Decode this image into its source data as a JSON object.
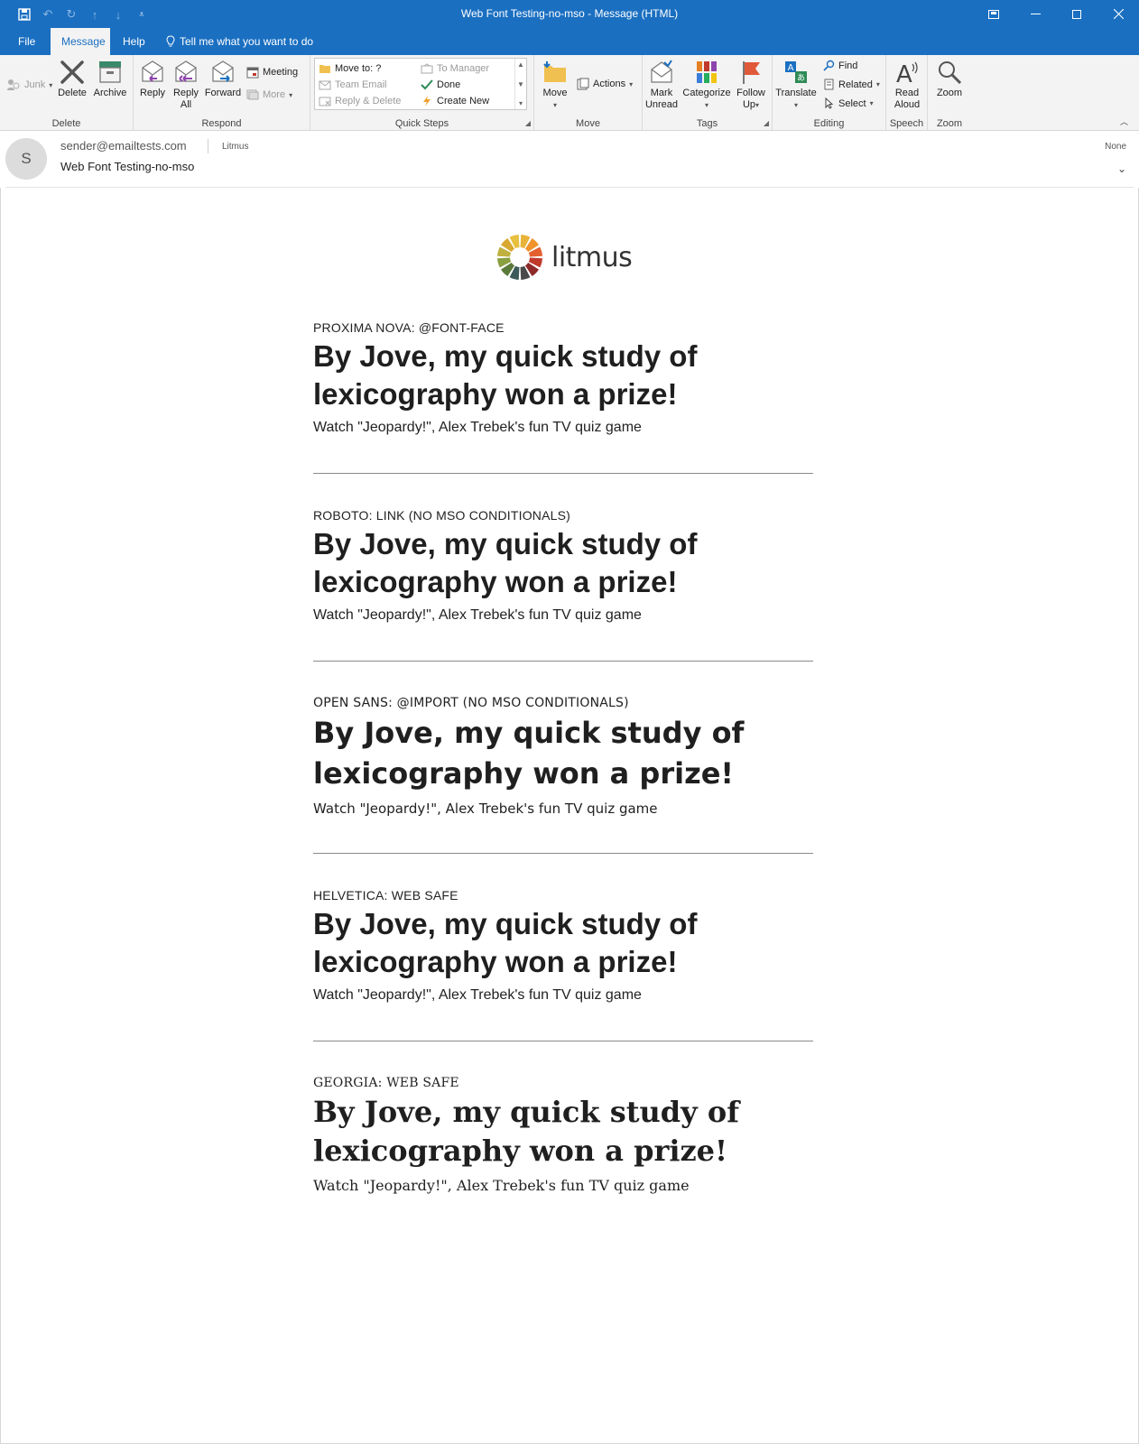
{
  "window": {
    "title": "Web Font Testing-no-mso  -  Message (HTML)"
  },
  "tabs": [
    {
      "label": "File"
    },
    {
      "label": "Message"
    },
    {
      "label": "Help"
    },
    {
      "label": "Tell me what you want to do"
    }
  ],
  "ribbon": {
    "delete_group": {
      "label": "Delete",
      "junk": "Junk",
      "delete": "Delete",
      "archive": "Archive"
    },
    "respond_group": {
      "label": "Respond",
      "reply": "Reply",
      "reply_all_1": "Reply",
      "reply_all_2": "All",
      "forward": "Forward",
      "meeting": "Meeting",
      "more": "More"
    },
    "quicksteps_group": {
      "label": "Quick Steps",
      "move_to": "Move to: ?",
      "team_email": "Team Email",
      "reply_delete": "Reply & Delete",
      "to_manager": "To Manager",
      "done": "Done",
      "create_new": "Create New"
    },
    "move_group": {
      "label": "Move",
      "move": "Move",
      "actions": "Actions"
    },
    "tags_group": {
      "label": "Tags",
      "mark_unread_1": "Mark",
      "mark_unread_2": "Unread",
      "categorize": "Categorize",
      "follow_up_1": "Follow",
      "follow_up_2": "Up"
    },
    "editing_group": {
      "label": "Editing",
      "translate": "Translate",
      "find": "Find",
      "related": "Related",
      "select": "Select"
    },
    "speech_group": {
      "label": "Speech",
      "read_aloud_1": "Read",
      "read_aloud_2": "Aloud"
    },
    "zoom_group": {
      "label": "Zoom",
      "zoom": "Zoom"
    }
  },
  "message": {
    "avatar_initial": "S",
    "from": "sender@emailtests.com",
    "to": "Litmus",
    "subject": "Web Font Testing-no-mso",
    "retention": "None"
  },
  "email": {
    "logo_text": "litmus",
    "sections": [
      {
        "label": "PROXIMA NOVA: @FONT-FACE",
        "headline": "By Jove, my quick study of lexicography won a prize!",
        "sub": "Watch \"Jeopardy!\", Alex Trebek's fun TV quiz game"
      },
      {
        "label": "ROBOTO: LINK (NO MSO CONDITIONALS)",
        "headline": "By Jove, my quick study of lexicography won a prize!",
        "sub": "Watch \"Jeopardy!\", Alex Trebek's fun TV quiz game"
      },
      {
        "label": "OPEN SANS: @IMPORT (NO MSO CONDITIONALS)",
        "headline": "By Jove, my quick study of lexicography won a prize!",
        "sub": "Watch \"Jeopardy!\", Alex Trebek's fun TV quiz game"
      },
      {
        "label": "HELVETICA: WEB SAFE",
        "headline": "By Jove, my quick study of lexicography won a prize!",
        "sub": "Watch \"Jeopardy!\", Alex Trebek's fun TV quiz game"
      },
      {
        "label": "GEORGIA: WEB SAFE",
        "headline": "By Jove, my quick study of lexicography won a prize!",
        "sub": "Watch \"Jeopardy!\", Alex Trebek's fun TV quiz game"
      }
    ]
  },
  "colors": {
    "accent": "#1a6fc1",
    "ribbon_bg": "#f3f3f3"
  }
}
